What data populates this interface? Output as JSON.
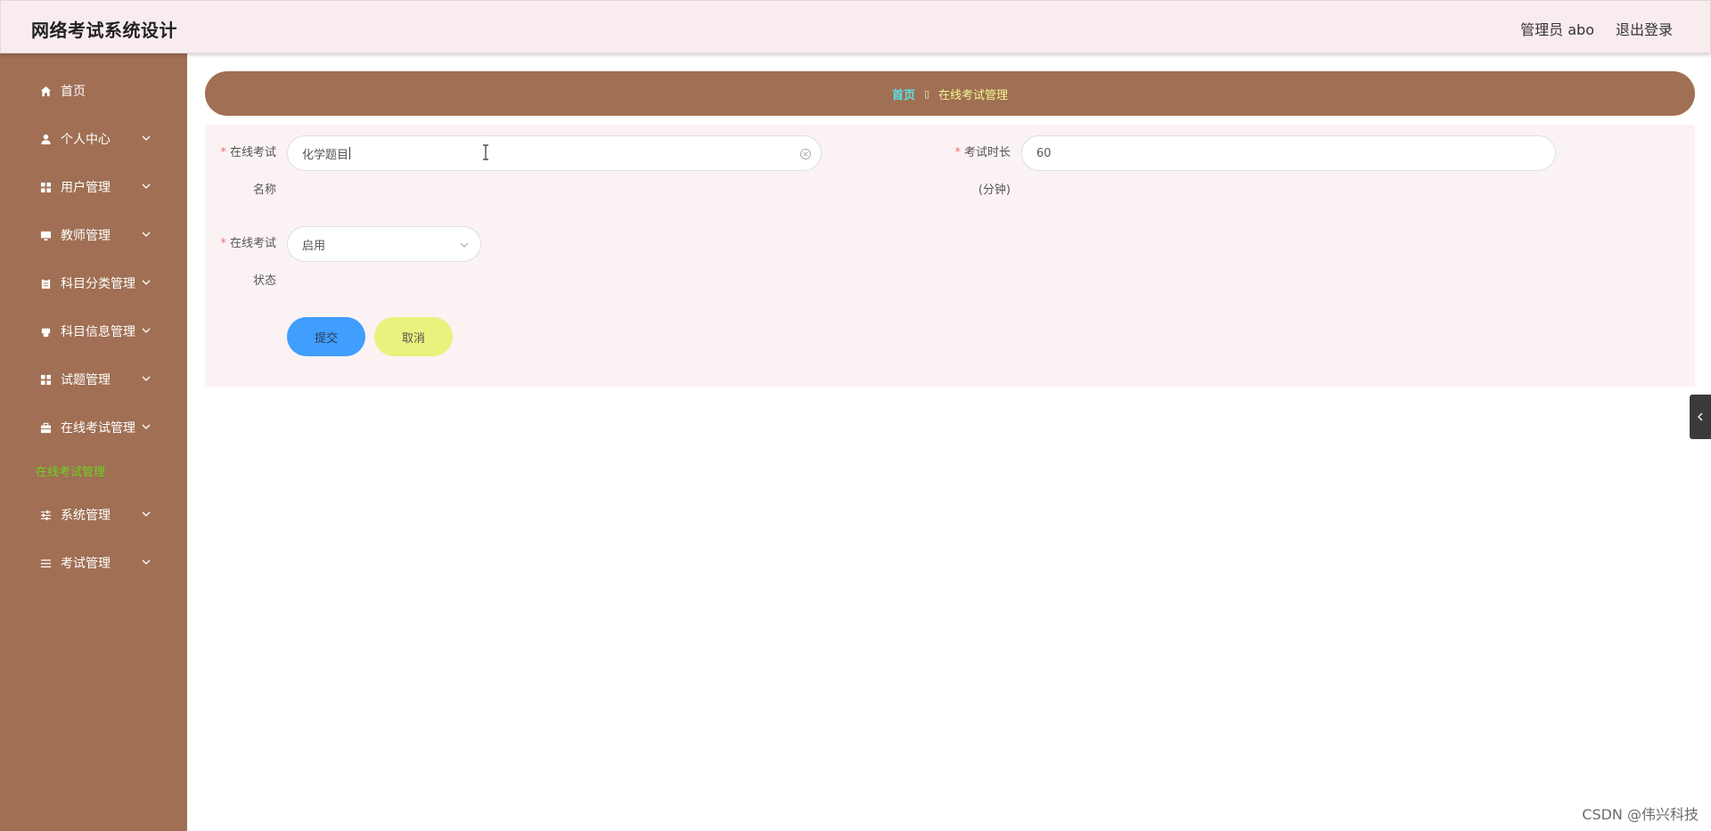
{
  "header": {
    "title": "网络考试系统设计",
    "user_label": "管理员 abo",
    "logout_label": "退出登录"
  },
  "sidebar": {
    "items": [
      {
        "label": "首页",
        "icon": "home-icon",
        "has_chevron": false
      },
      {
        "label": "个人中心",
        "icon": "user-icon",
        "has_chevron": true
      },
      {
        "label": "用户管理",
        "icon": "grid-icon",
        "has_chevron": true
      },
      {
        "label": "教师管理",
        "icon": "monitor-icon",
        "has_chevron": true
      },
      {
        "label": "科目分类管理",
        "icon": "clipboard-icon",
        "has_chevron": true
      },
      {
        "label": "科目信息管理",
        "icon": "printer-icon",
        "has_chevron": true
      },
      {
        "label": "试题管理",
        "icon": "grid-icon",
        "has_chevron": true
      },
      {
        "label": "在线考试管理",
        "icon": "briefcase-icon",
        "has_chevron": true
      },
      {
        "label": "系统管理",
        "icon": "sliders-icon",
        "has_chevron": true
      },
      {
        "label": "考试管理",
        "icon": "list-icon",
        "has_chevron": true
      }
    ],
    "active_submenu": "在线考试管理"
  },
  "breadcrumb": {
    "home": "首页",
    "separator": "▯",
    "current": "在线考试管理"
  },
  "form": {
    "exam_name": {
      "label_line1": "在线考试",
      "label_line2": "名称",
      "value": "化学题目"
    },
    "exam_duration": {
      "label_line1": "考试时长",
      "label_line2": "(分钟)",
      "value": "60"
    },
    "exam_status": {
      "label_line1": "在线考试",
      "label_line2": "状态",
      "value": "启用"
    },
    "required_mark": "*",
    "submit_label": "提交",
    "cancel_label": "取消"
  },
  "watermark": "CSDN @伟兴科技",
  "colors": {
    "sidebar_bg": "#a06f54",
    "header_bg": "#f8ecef",
    "submenu_active": "#6bd21f",
    "submit": "#409eff",
    "cancel": "#e9f27c"
  }
}
